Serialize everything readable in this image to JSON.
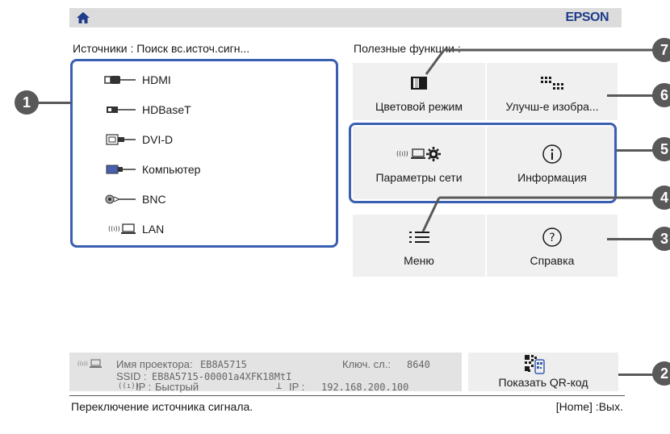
{
  "header": {
    "brand": "EPSON",
    "home_icon": "home-icon"
  },
  "sources": {
    "heading": "Источники : Поиск вс.источ.сигн...",
    "items": [
      {
        "label": "HDMI",
        "icon": "hdmi-connector-icon"
      },
      {
        "label": "HDBaseT",
        "icon": "hdbaset-connector-icon"
      },
      {
        "label": "DVI-D",
        "icon": "dvi-connector-icon"
      },
      {
        "label": "Компьютер",
        "icon": "vga-connector-icon"
      },
      {
        "label": "BNC",
        "icon": "bnc-connector-icon"
      },
      {
        "label": "LAN",
        "icon": "lan-network-icon"
      }
    ]
  },
  "functions": {
    "heading": "Полезные функции :",
    "tiles": [
      {
        "label": "Цветовой режим",
        "icon": "color-mode-icon"
      },
      {
        "label": "Улучш-е изобра...",
        "icon": "image-enhance-icon"
      },
      {
        "label": "Параметры сети",
        "icon": "network-settings-icon"
      },
      {
        "label": "Информация",
        "icon": "info-icon"
      },
      {
        "label": "Меню",
        "icon": "menu-list-icon"
      },
      {
        "label": "Справка",
        "icon": "help-icon"
      }
    ]
  },
  "callouts": [
    "1",
    "2",
    "3",
    "4",
    "5",
    "6",
    "7"
  ],
  "network_info": {
    "projector_name_label": "Имя проектора:",
    "projector_name": "EB8A5715",
    "key_label": "Ключ. сл.:",
    "key": "8640",
    "ssid_label": "SSID :",
    "ssid": "EB8A5715-00001a4XFK18MtI",
    "wireless_ip_label": "IP :",
    "wireless_ip": "Быстрый",
    "wired_ip_label": "IP :",
    "wired_ip": "192.168.200.100"
  },
  "qr": {
    "label": "Показать QR-код",
    "icon": "qr-code-icon"
  },
  "status": {
    "left": "Переключение источника сигнала.",
    "right": "[Home] :Вых."
  }
}
